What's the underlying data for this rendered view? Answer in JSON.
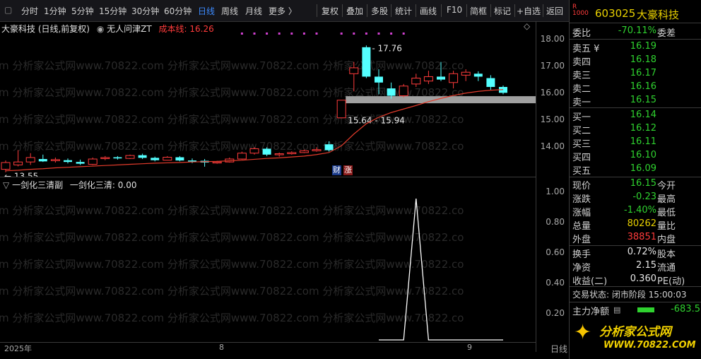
{
  "toolbar": {
    "periods": [
      "分时",
      "1分钟",
      "5分钟",
      "15分钟",
      "30分钟",
      "60分钟",
      "日线",
      "周线",
      "月线",
      "更多 〉"
    ],
    "active_period": "日线",
    "actions": [
      "复权",
      "叠加",
      "多股",
      "统计",
      "画线",
      "F10",
      "简框",
      "标记",
      "+自选",
      "返回"
    ]
  },
  "chart": {
    "title": "大豪科技 (日线,前复权)",
    "indicator_name": "无人问津ZT",
    "cost_line_label": "成本线: 16.26",
    "high_label": "17.76",
    "low_label": "13.55",
    "band_label": "15.64 - 15.94",
    "badge_cai": "财",
    "badge_zhang": "涨",
    "sub_title": "一剑化三清副",
    "sub_value": "一剑化三清: 0.00",
    "price_ticks": [
      "18.00",
      "17.00",
      "16.00",
      "15.00",
      "14.00"
    ],
    "ind_ticks": [
      "1.00",
      "0.80",
      "0.60",
      "0.40",
      "0.20"
    ],
    "date_labels": [
      "2025年",
      "8",
      "9"
    ],
    "date_axis_right": "日线",
    "watermark": "m 分析家公式网www.70822.com 分析家公式网www.70822.com 分析家公式网www.70822.co",
    "colors": {
      "up": "#ff3b3b",
      "down": "#54ffff",
      "cost": "#e23b2b",
      "band": "#a0a0a0"
    }
  },
  "chart_data": [
    {
      "type": "candlestick",
      "title": "大豪科技 (日线,前复权)",
      "ylim": [
        13.3,
        18.2
      ],
      "candles": [
        {
          "o": 13.55,
          "h": 13.85,
          "l": 13.45,
          "c": 13.78
        },
        {
          "o": 13.7,
          "h": 14.2,
          "l": 13.65,
          "c": 13.8
        },
        {
          "o": 13.8,
          "h": 14.1,
          "l": 13.7,
          "c": 13.95
        },
        {
          "o": 13.9,
          "h": 14.05,
          "l": 13.8,
          "c": 13.82
        },
        {
          "o": 13.85,
          "h": 13.95,
          "l": 13.78,
          "c": 13.88
        },
        {
          "o": 13.86,
          "h": 13.92,
          "l": 13.75,
          "c": 13.8
        },
        {
          "o": 13.8,
          "h": 13.88,
          "l": 13.7,
          "c": 13.74
        },
        {
          "o": 13.72,
          "h": 13.95,
          "l": 13.7,
          "c": 13.9
        },
        {
          "o": 13.92,
          "h": 14.0,
          "l": 13.86,
          "c": 13.95
        },
        {
          "o": 13.96,
          "h": 14.0,
          "l": 13.88,
          "c": 13.92
        },
        {
          "o": 13.92,
          "h": 14.05,
          "l": 13.9,
          "c": 14.02
        },
        {
          "o": 14.03,
          "h": 14.08,
          "l": 13.9,
          "c": 13.94
        },
        {
          "o": 13.94,
          "h": 13.98,
          "l": 13.82,
          "c": 13.86
        },
        {
          "o": 13.86,
          "h": 14.0,
          "l": 13.85,
          "c": 13.96
        },
        {
          "o": 13.96,
          "h": 14.0,
          "l": 13.82,
          "c": 13.85
        },
        {
          "o": 13.85,
          "h": 13.92,
          "l": 13.76,
          "c": 13.82
        },
        {
          "o": 13.84,
          "h": 13.9,
          "l": 13.64,
          "c": 13.78
        },
        {
          "o": 13.78,
          "h": 13.84,
          "l": 13.74,
          "c": 13.8
        },
        {
          "o": 13.8,
          "h": 13.95,
          "l": 13.78,
          "c": 13.9
        },
        {
          "o": 13.9,
          "h": 14.15,
          "l": 13.88,
          "c": 14.1
        },
        {
          "o": 14.1,
          "h": 14.3,
          "l": 14.05,
          "c": 14.25
        },
        {
          "o": 14.25,
          "h": 14.3,
          "l": 14.0,
          "c": 14.05
        },
        {
          "o": 14.05,
          "h": 14.12,
          "l": 13.98,
          "c": 14.08
        },
        {
          "o": 14.08,
          "h": 14.16,
          "l": 14.05,
          "c": 14.12
        },
        {
          "o": 14.12,
          "h": 14.22,
          "l": 14.1,
          "c": 14.18
        },
        {
          "o": 14.18,
          "h": 14.3,
          "l": 14.15,
          "c": 14.22
        },
        {
          "o": 14.4,
          "h": 14.5,
          "l": 14.15,
          "c": 14.2
        },
        {
          "o": 15.3,
          "h": 15.9,
          "l": 15.3,
          "c": 15.9
        },
        {
          "o": 16.8,
          "h": 17.2,
          "l": 16.2,
          "c": 17.0
        },
        {
          "o": 17.7,
          "h": 17.76,
          "l": 16.65,
          "c": 16.7
        },
        {
          "o": 16.7,
          "h": 16.95,
          "l": 16.1,
          "c": 16.5
        },
        {
          "o": 16.3,
          "h": 16.5,
          "l": 15.95,
          "c": 16.05
        },
        {
          "o": 16.05,
          "h": 16.45,
          "l": 16.0,
          "c": 16.38
        },
        {
          "o": 16.45,
          "h": 16.8,
          "l": 16.35,
          "c": 16.65
        },
        {
          "o": 16.55,
          "h": 16.9,
          "l": 16.45,
          "c": 16.7
        },
        {
          "o": 16.7,
          "h": 17.2,
          "l": 16.55,
          "c": 16.6
        },
        {
          "o": 16.5,
          "h": 16.9,
          "l": 16.3,
          "c": 16.8
        },
        {
          "o": 16.75,
          "h": 16.95,
          "l": 16.55,
          "c": 16.85
        },
        {
          "o": 16.8,
          "h": 16.88,
          "l": 16.55,
          "c": 16.7
        },
        {
          "o": 16.65,
          "h": 16.75,
          "l": 16.25,
          "c": 16.35
        },
        {
          "o": 16.35,
          "h": 16.4,
          "l": 16.1,
          "c": 16.15
        }
      ],
      "cost_line": [
        13.5,
        13.52,
        13.55,
        13.57,
        13.6,
        13.62,
        13.64,
        13.66,
        13.68,
        13.7,
        13.72,
        13.74,
        13.76,
        13.77,
        13.78,
        13.8,
        13.81,
        13.82,
        13.84,
        13.86,
        13.89,
        13.92,
        13.94,
        13.97,
        14.0,
        14.05,
        14.12,
        14.35,
        14.75,
        15.1,
        15.32,
        15.48,
        15.6,
        15.72,
        15.85,
        15.96,
        16.06,
        16.14,
        16.2,
        16.24,
        16.26
      ],
      "band": [
        15.64,
        15.94
      ]
    },
    {
      "type": "line",
      "title": "一剑化三清副",
      "series": [
        {
          "name": "一剑化三清",
          "values": [
            0,
            0,
            0,
            0,
            0,
            0,
            0,
            0,
            0,
            0,
            0,
            0,
            0,
            0,
            0,
            0,
            0,
            0,
            0,
            0,
            0,
            0,
            0,
            0,
            0,
            0,
            0,
            0,
            0,
            0,
            0,
            0,
            0,
            1,
            0,
            0,
            0,
            0,
            0,
            0,
            0
          ]
        }
      ],
      "ylim": [
        0,
        1.05
      ]
    }
  ],
  "panel": {
    "code": "603025",
    "name": "大豪科技",
    "wb_label": "委比",
    "wb_value": "-70.11%",
    "wc_label": "委差",
    "asks": [
      {
        "label": "卖五 ¥",
        "price": "16.19"
      },
      {
        "label": "卖四",
        "price": "16.18"
      },
      {
        "label": "卖三",
        "price": "16.17"
      },
      {
        "label": "卖二",
        "price": "16.16"
      },
      {
        "label": "卖一",
        "price": "16.15"
      }
    ],
    "bids": [
      {
        "label": "买一",
        "price": "16.14"
      },
      {
        "label": "买二",
        "price": "16.12"
      },
      {
        "label": "买三",
        "price": "16.11"
      },
      {
        "label": "买四",
        "price": "16.10"
      },
      {
        "label": "买五",
        "price": "16.09"
      }
    ],
    "stats": [
      {
        "l1": "现价",
        "v": "16.15",
        "c": "green",
        "l2": "今开"
      },
      {
        "l1": "涨跌",
        "v": "-0.23",
        "c": "green",
        "l2": "最高"
      },
      {
        "l1": "涨幅",
        "v": "-1.40%",
        "c": "green",
        "l2": "最低"
      },
      {
        "l1": "总量",
        "v": "80262",
        "c": "yellow",
        "l2": "量比"
      },
      {
        "l1": "外盘",
        "v": "38851",
        "c": "red",
        "l2": "内盘"
      }
    ],
    "stats2": [
      {
        "l1": "换手",
        "v": "0.72%",
        "c": "white",
        "l2": "股本"
      },
      {
        "l1": "净资",
        "v": "2.15",
        "c": "white",
        "l2": "流通"
      },
      {
        "l1": "收益(二)",
        "v": "0.360",
        "c": "white",
        "l2": "PE(动)"
      }
    ],
    "trade_status": "交易状态: 闭市阶段 15:00:03",
    "main_flow_label": "主力净额",
    "main_flow_value": "-683.5",
    "logo_text": "分析家公式网",
    "logo_url": "WWW.70822.COM"
  }
}
